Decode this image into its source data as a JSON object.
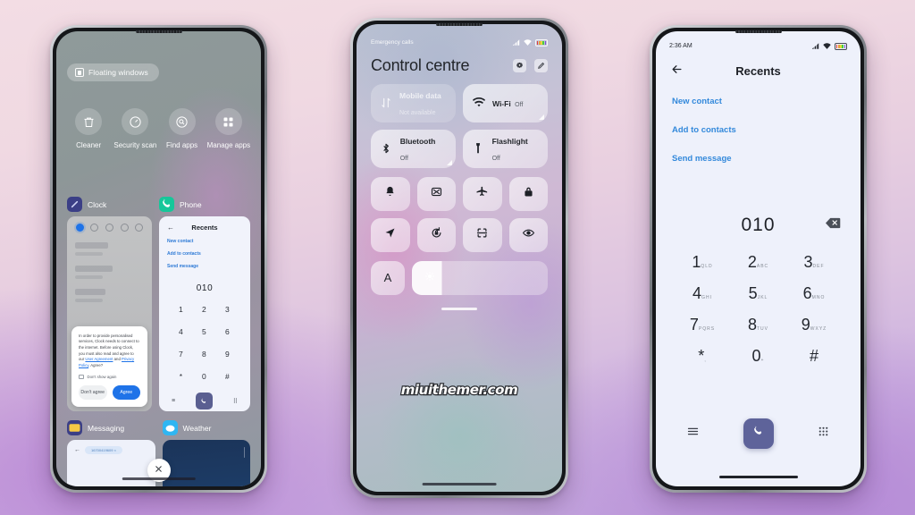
{
  "phone1": {
    "floating_windows": {
      "label": "Floating windows",
      "icon": "floating-window-icon"
    },
    "tools": [
      {
        "label": "Cleaner",
        "icon": "trash-icon"
      },
      {
        "label": "Security scan",
        "icon": "shield-scan-icon"
      },
      {
        "label": "Find apps",
        "icon": "search-app-icon"
      },
      {
        "label": "Manage apps",
        "icon": "grid-apps-icon"
      }
    ],
    "apps": [
      {
        "name": "Clock",
        "icon": "clock-app-icon",
        "color": "#3b3f86"
      },
      {
        "name": "Phone",
        "icon": "phone-app-icon",
        "color": "#16c79a"
      },
      {
        "name": "Messaging",
        "icon": "messaging-app-icon",
        "color": "#3b3f86"
      },
      {
        "name": "Weather",
        "icon": "weather-app-icon",
        "color": "#2fb6f2"
      }
    ],
    "clock_dialog": {
      "body_1": "In order to provide personalised services, Clock needs to connect to the internet. Before using Clock, you must also read and agree to our ",
      "link_1": "User Agreement",
      "body_2": " and ",
      "link_2": "Privacy Policy",
      "body_3": ". Agree?",
      "checkbox": "Don't show again",
      "decline": "Don't agree",
      "accept": "Agree"
    },
    "dialer_preview": {
      "title": "Recents",
      "links": [
        "New contact",
        "Add to contacts",
        "Send message"
      ],
      "number": "010",
      "keys": [
        "1",
        "2",
        "3",
        "4",
        "5",
        "6",
        "7",
        "8",
        "9",
        "*",
        "0",
        "#"
      ]
    },
    "close_button": "close-icon"
  },
  "phone2": {
    "status": {
      "emergency": "Emergency calls",
      "signal": "signal-icon",
      "wifi": "wifi-icon",
      "battery": "battery-rainbow-icon"
    },
    "title": "Control centre",
    "actions": [
      {
        "name": "settings-gear-icon"
      },
      {
        "name": "edit-pencil-icon"
      }
    ],
    "big_tiles": [
      {
        "title": "Mobile data",
        "subtitle": "Not available",
        "icon": "mobile-data-icon",
        "enabled": false
      },
      {
        "title": "Wi-Fi",
        "subtitle": "Off",
        "icon": "wifi-icon",
        "enabled": true
      },
      {
        "title": "Bluetooth",
        "subtitle": "Off",
        "icon": "bluetooth-icon",
        "enabled": true
      },
      {
        "title": "Flashlight",
        "subtitle": "Off",
        "icon": "flashlight-icon",
        "enabled": true
      }
    ],
    "square_tiles": [
      "bell-silent-icon",
      "screenshot-icon",
      "airplane-icon",
      "lock-icon",
      "location-icon",
      "rotation-lock-icon",
      "scan-icon",
      "eye-care-icon"
    ],
    "brightness": {
      "auto_label": "A",
      "icon": "brightness-icon",
      "level": 22
    },
    "watermark": "miuithemer.com"
  },
  "phone3": {
    "status": {
      "time": "2:36 AM",
      "signal": "signal-icon",
      "wifi": "wifi-icon",
      "battery": "battery-rainbow-icon"
    },
    "header": {
      "back": "back-arrow-icon",
      "title": "Recents"
    },
    "links": [
      "New contact",
      "Add to contacts",
      "Send message"
    ],
    "number": "010",
    "delete": "backspace-icon",
    "keypad": [
      {
        "digit": "1",
        "letters": "QLD"
      },
      {
        "digit": "2",
        "letters": "ABC"
      },
      {
        "digit": "3",
        "letters": "DEF"
      },
      {
        "digit": "4",
        "letters": "GHI"
      },
      {
        "digit": "5",
        "letters": "JKL"
      },
      {
        "digit": "6",
        "letters": "MNO"
      },
      {
        "digit": "7",
        "letters": "PQRS"
      },
      {
        "digit": "8",
        "letters": "TUV"
      },
      {
        "digit": "9",
        "letters": "WXYZ"
      },
      {
        "digit": "*",
        "letters": ","
      },
      {
        "digit": "0",
        "letters": "+"
      },
      {
        "digit": "#",
        "letters": ""
      }
    ],
    "bottom": {
      "menu": "menu-icon",
      "call": "call-icon",
      "keypad_toggle": "keypad-icon"
    }
  }
}
